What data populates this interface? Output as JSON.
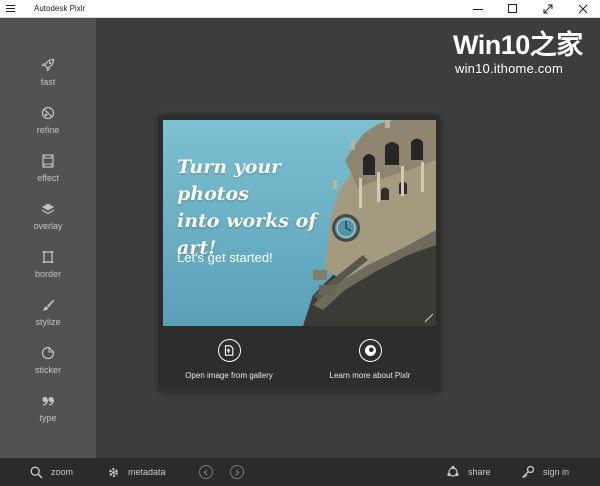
{
  "window": {
    "title": "Autodesk Pixlr",
    "menu_icon": "hamburger-icon",
    "controls": [
      "minimize-icon",
      "maximize-icon",
      "fullscreen-icon",
      "close-icon"
    ]
  },
  "sidebar": {
    "items": [
      {
        "label": "fast",
        "icon": "rocket-icon"
      },
      {
        "label": "refine",
        "icon": "refine-icon"
      },
      {
        "label": "effect",
        "icon": "film-icon"
      },
      {
        "label": "overlay",
        "icon": "layers-icon"
      },
      {
        "label": "border",
        "icon": "border-icon"
      },
      {
        "label": "stylize",
        "icon": "brush-icon"
      },
      {
        "label": "sticker",
        "icon": "sticker-icon"
      },
      {
        "label": "type",
        "icon": "quote-icon"
      }
    ]
  },
  "watermark": {
    "title": "Win10之家",
    "subtitle": "win10.ithome.com"
  },
  "welcome": {
    "headline_line1": "Turn your photos",
    "headline_line2": "into works of art!",
    "subline": "Let's get started!",
    "open_gallery_label": "Open image from gallery",
    "learn_more_label": "Learn more about Pixlr"
  },
  "bottombar": {
    "zoom_label": "zoom",
    "metadata_label": "metadata",
    "share_label": "share",
    "signin_label": "sign in"
  },
  "colors": {
    "titlebar": "#ffffff",
    "sidebar": "#525252",
    "canvas": "#3d3d3d",
    "bottombar": "#2b2b2b",
    "sky": "#6fb3c6"
  }
}
